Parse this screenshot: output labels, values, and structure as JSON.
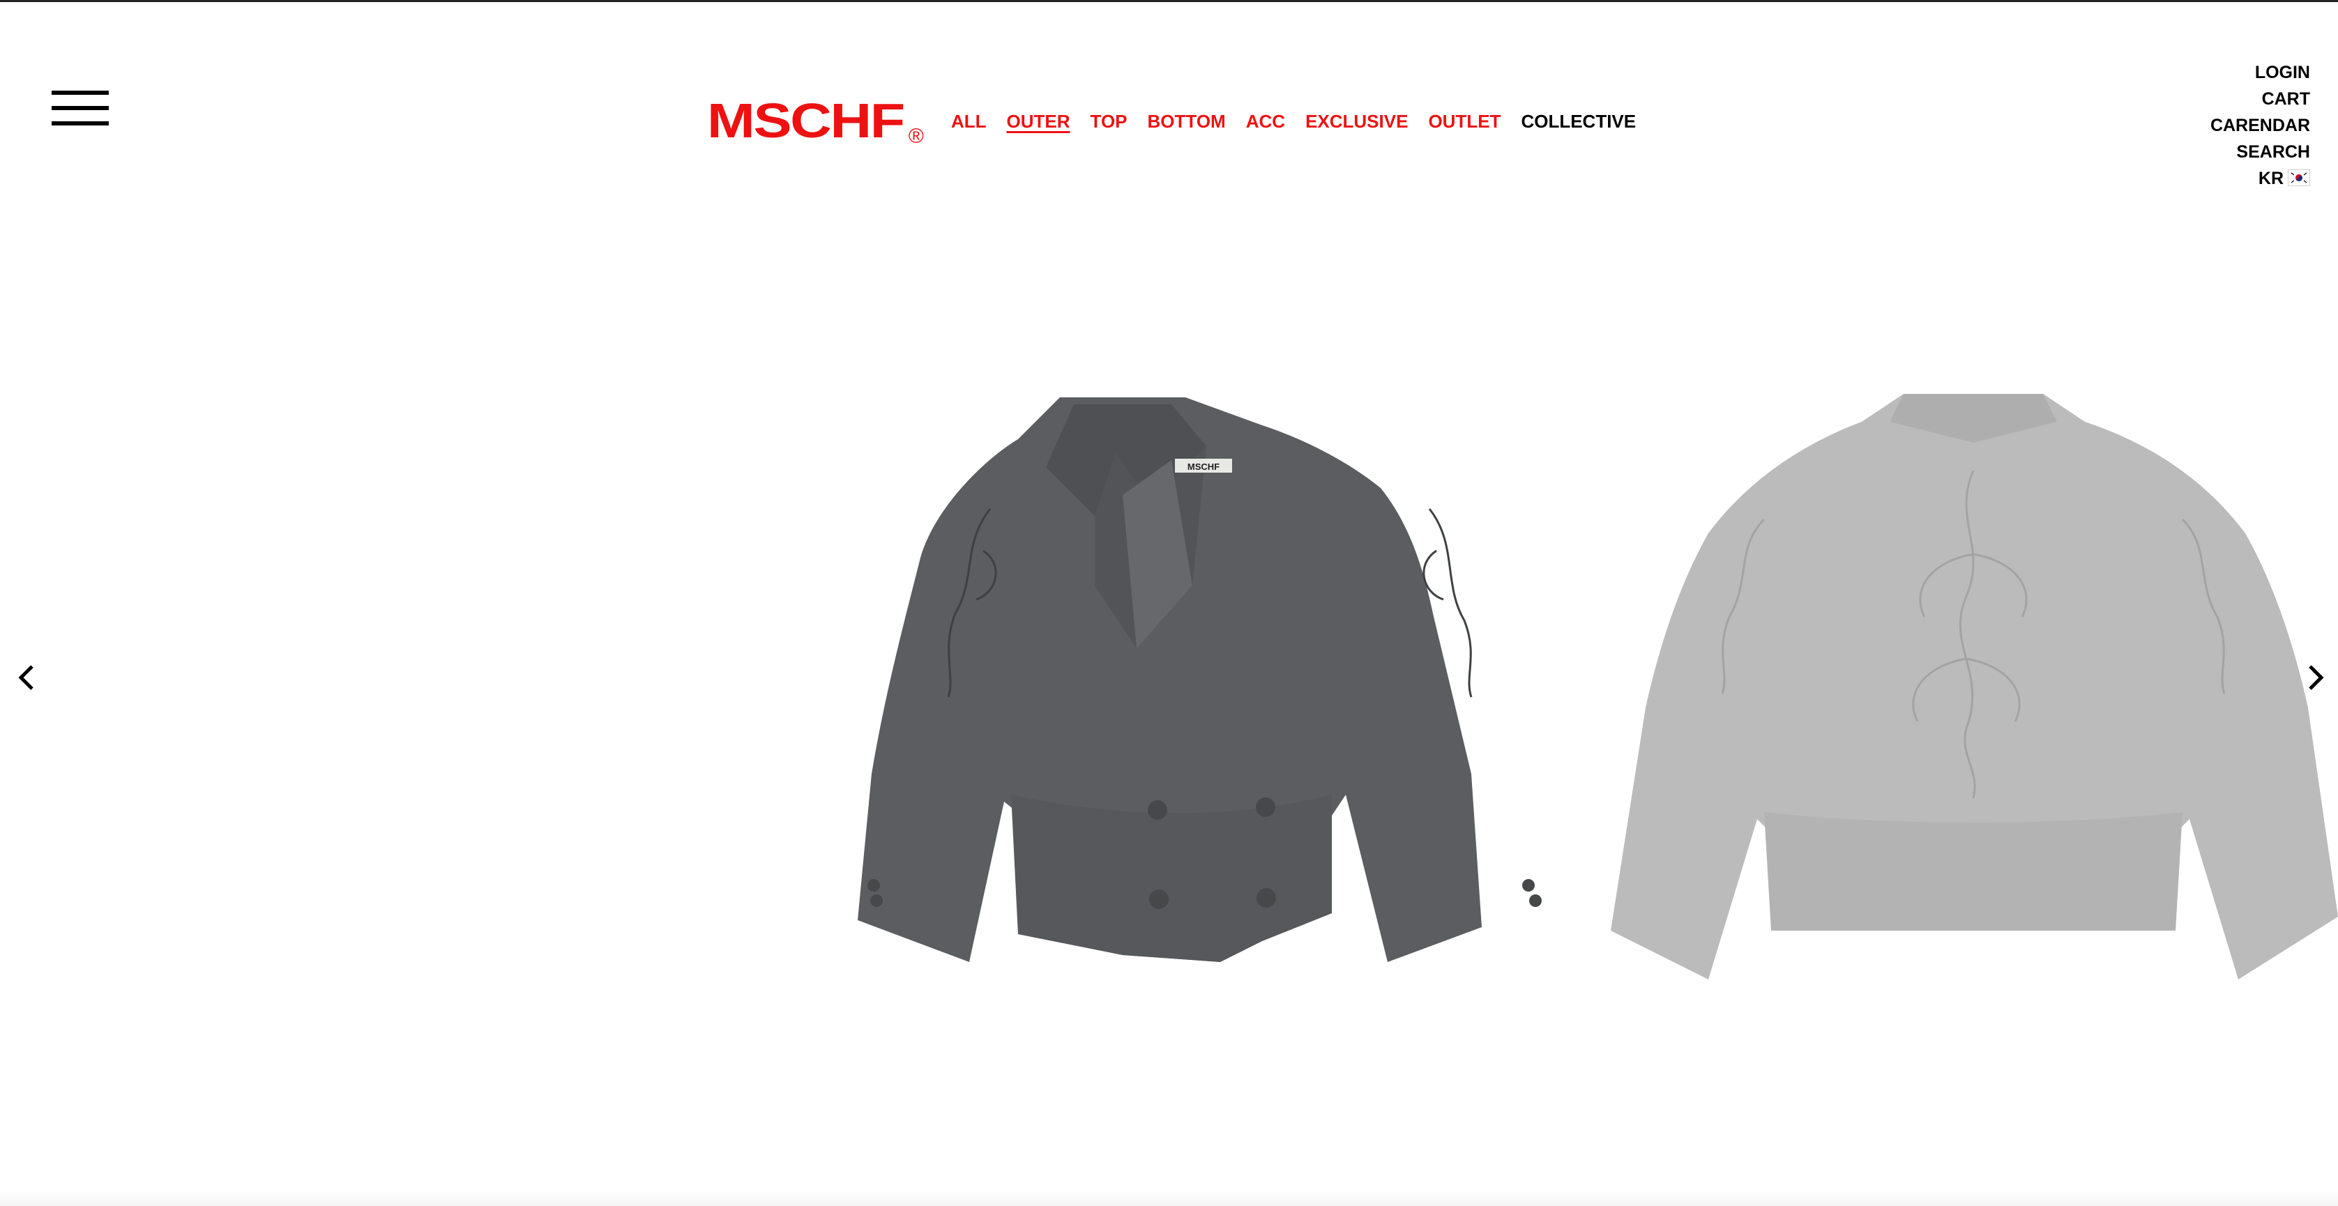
{
  "brand": {
    "logo_text": "MSCHF",
    "logo_mark": "®",
    "color": "#ee1111"
  },
  "main_nav": {
    "items": [
      {
        "label": "ALL"
      },
      {
        "label": "OUTER",
        "active": true
      },
      {
        "label": "TOP"
      },
      {
        "label": "BOTTOM"
      },
      {
        "label": "ACC"
      },
      {
        "label": "EXCLUSIVE"
      },
      {
        "label": "OUTLET"
      },
      {
        "label": "COLLECTIVE"
      }
    ]
  },
  "util_nav": {
    "login": "LOGIN",
    "cart": "CART",
    "calendar": "CARENDAR",
    "search": "SEARCH",
    "language": "KR"
  },
  "carousel": {
    "prev_icon": "chevron-left-icon",
    "next_icon": "chevron-right-icon",
    "slides": [
      {
        "label_on_garment": "MSCHF",
        "color": "#5b5d60"
      },
      {
        "color": "#b4b4b4"
      }
    ]
  },
  "menu_icon": "hamburger-menu-icon"
}
